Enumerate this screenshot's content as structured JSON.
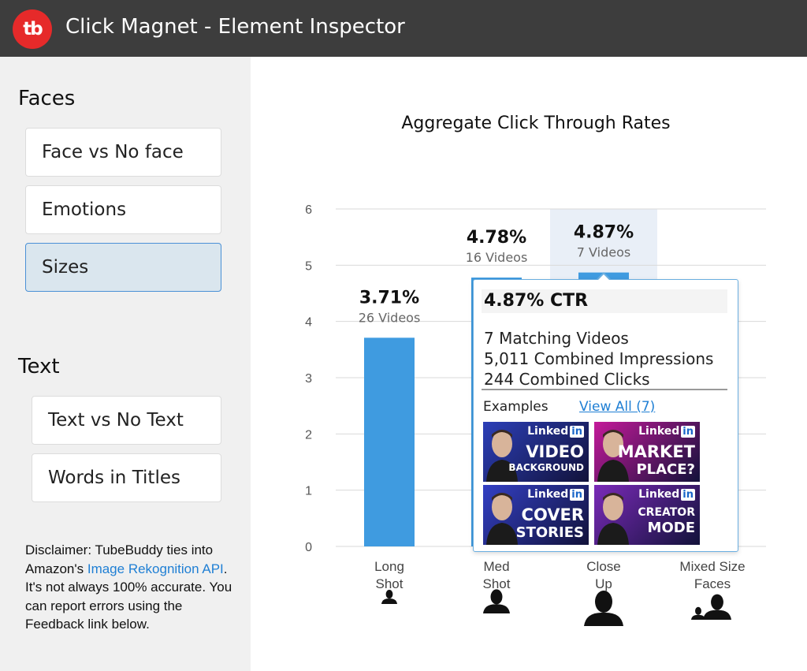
{
  "app": {
    "logo_text": "tb",
    "title": "Click Magnet - Element Inspector"
  },
  "sidebar": {
    "faces_heading": "Faces",
    "faces_items": [
      {
        "label": "Face vs No face",
        "active": false
      },
      {
        "label": "Emotions",
        "active": false
      },
      {
        "label": "Sizes",
        "active": true
      }
    ],
    "text_heading": "Text",
    "text_items": [
      {
        "label": "Text vs No Text"
      },
      {
        "label": "Words in Titles"
      }
    ],
    "disclaimer": {
      "before": "Disclaimer: TubeBuddy ties into Amazon's ",
      "link": "Image Rekognition API",
      "after": ". It's not always 100% accurate. You can report errors using the Feedback link below."
    }
  },
  "chart_data": {
    "type": "bar",
    "title": "Aggregate Click Through Rates",
    "categories": [
      "Long Shot",
      "Med Shot",
      "Close Up",
      "Mixed Size Faces"
    ],
    "category_lines": [
      [
        "Long",
        "Shot"
      ],
      [
        "Med",
        "Shot"
      ],
      [
        "Close",
        "Up"
      ],
      [
        "Mixed Size",
        "Faces"
      ]
    ],
    "category_icons": [
      "person-small-icon",
      "person-medium-icon",
      "person-large-icon",
      "people-mixed-icon"
    ],
    "values": [
      3.71,
      4.78,
      4.87,
      null
    ],
    "value_labels": [
      "3.71%",
      "4.78%",
      "4.87%",
      ""
    ],
    "count_labels": [
      "26 Videos",
      "16 Videos",
      "7 Videos",
      ""
    ],
    "ylim": [
      0,
      6
    ],
    "yticks": [
      0,
      1,
      2,
      3,
      4,
      5,
      6
    ],
    "grid": true,
    "highlighted_category": "Close Up",
    "bar_color": "#3f9be0"
  },
  "tooltip": {
    "header": "4.87% CTR",
    "lines": [
      "7 Matching Videos",
      "5,011 Combined Impressions",
      "244 Combined Clicks"
    ],
    "examples_label": "Examples",
    "view_all": "View All (7)",
    "thumbnails": [
      {
        "brand": "Linked",
        "brand_in": "in",
        "line1": "VIDEO",
        "line2": "BACKGROUND",
        "bg": "#2c3fb8"
      },
      {
        "brand": "Linked",
        "brand_in": "in",
        "line1": "MARKET",
        "line2": "PLACE?",
        "bg": "#c41a9a"
      },
      {
        "brand": "Linked",
        "brand_in": "in",
        "line1": "COVER",
        "line2": "STORIES",
        "bg": "#3340c4"
      },
      {
        "brand": "Linked",
        "brand_in": "in",
        "line1": "CREATOR",
        "line2": "MODE",
        "bg": "#7a2ab8"
      }
    ]
  }
}
